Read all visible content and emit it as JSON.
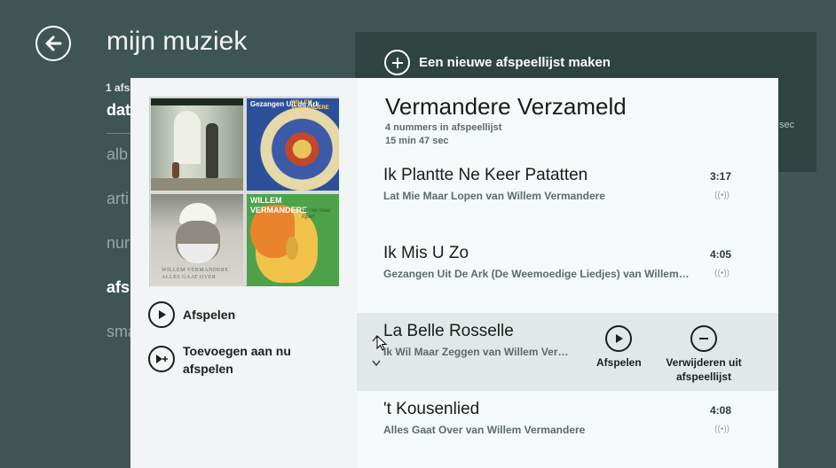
{
  "background": {
    "title": "mijn muziek",
    "count_label": "1 afs",
    "nav": [
      "dat",
      "alb",
      "arti",
      "nur",
      "afs",
      "sma"
    ],
    "new_playlist_label": "Een nieuwe afspeellijst maken",
    "duration_fragment": "sec"
  },
  "album_art": {
    "art2_text": "Gezangen Uit de Ark",
    "art2_artist": "WILLEM VERMANDERE",
    "art3_text": "WILLEM VERMANDERE",
    "art3_sub": "ALLES GAAT OVER",
    "art4_text": "WILLEM VERMANDERE",
    "art4_sub": "lat mie maar lopen"
  },
  "left_actions": {
    "play_label": "Afspelen",
    "add_now_playing_label": "Toevoegen aan nu afspelen"
  },
  "playlist": {
    "title": "Vermandere Verzameld",
    "track_count": "4 nummers in afspeellijst",
    "total_duration": "15 min 47 sec"
  },
  "tracks": [
    {
      "title": "Ik Plantte Ne Keer Patatten",
      "subtitle": "Lat Mie Maar Lopen van Willem Vermandere",
      "duration": "3:17",
      "radio": "((•))"
    },
    {
      "title": "Ik Mis U Zo",
      "subtitle": "Gezangen Uit De Ark (De Weemoedige Liedjes) van Willem…",
      "duration": "4:05",
      "radio": "((•))"
    },
    {
      "title": "La Belle Rosselle",
      "subtitle": "Ik Wil Maar Zeggen van Willem Ver…",
      "play_label": "Afspelen",
      "remove_label": "Verwijderen uit afspeellijst"
    },
    {
      "title": "'t Kousenlied",
      "subtitle": "Alles Gaat Over van Willem Vermandere",
      "duration": "4:08",
      "radio": "((•))"
    }
  ]
}
